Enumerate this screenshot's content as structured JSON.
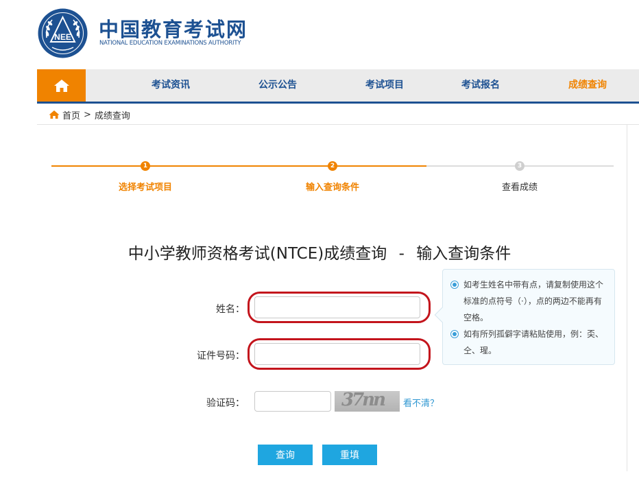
{
  "header": {
    "logo_text": "NEE",
    "brand_cn": "中国教育考试网",
    "brand_en": "NATIONAL EDUCATION EXAMINATIONS AUTHORITY"
  },
  "nav": {
    "items": [
      {
        "label": "考试资讯"
      },
      {
        "label": "公示公告"
      },
      {
        "label": "考试项目"
      },
      {
        "label": "考试报名"
      },
      {
        "label": "成绩查询"
      }
    ],
    "active_index": 4
  },
  "breadcrumb": {
    "home": "首页",
    "separator": ">",
    "current": "成绩查询"
  },
  "steps": [
    {
      "number": "1",
      "label": "选择考试项目",
      "state": "done"
    },
    {
      "number": "2",
      "label": "输入查询条件",
      "state": "current"
    },
    {
      "number": "3",
      "label": "查看成绩",
      "state": "pending"
    }
  ],
  "title": {
    "main": "中小学教师资格考试(NTCE)成绩查询",
    "separator": "-",
    "sub": "输入查询条件"
  },
  "form": {
    "name_label": "姓名：",
    "name_value": "",
    "id_label": "证件号码：",
    "id_value": "",
    "captcha_label": "验证码：",
    "captcha_value": "",
    "captcha_image_text": "37nn",
    "refresh_label": "看不清？"
  },
  "tips": [
    "如考生姓名中带有点，请复制使用这个标准的点符号（·），点的两边不能再有空格。",
    "如有所列孤僻字请粘贴使用，例：奀、仝、瑆。"
  ],
  "buttons": {
    "query": "查询",
    "reset": "重填"
  },
  "colors": {
    "brand_blue": "#1d5192",
    "accent_orange": "#f08300",
    "button_blue": "#1fa6e0",
    "highlight_red": "#c3141c",
    "step_pending": "#cfcfcf"
  }
}
